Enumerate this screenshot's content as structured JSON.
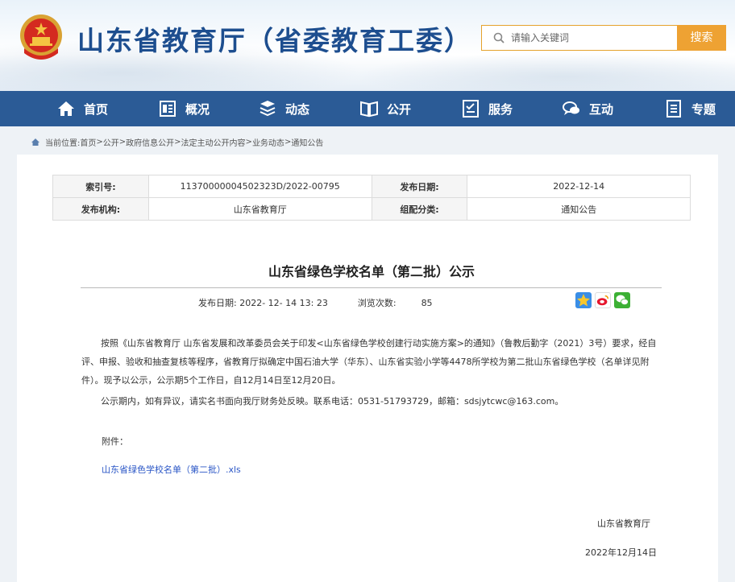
{
  "header": {
    "site_title": "山东省教育厅（省委教育工委）",
    "search_placeholder": "请输入关键词",
    "search_button": "搜索"
  },
  "nav": {
    "items": [
      {
        "label": "首页",
        "icon": "home-icon"
      },
      {
        "label": "概况",
        "icon": "overview-icon"
      },
      {
        "label": "动态",
        "icon": "news-icon"
      },
      {
        "label": "公开",
        "icon": "book-icon"
      },
      {
        "label": "服务",
        "icon": "service-icon"
      },
      {
        "label": "互动",
        "icon": "chat-icon"
      },
      {
        "label": "专题",
        "icon": "topic-icon"
      }
    ]
  },
  "breadcrumb": {
    "prefix": "当前位置:",
    "items": [
      "首页",
      "公开",
      "政府信息公开",
      "法定主动公开内容",
      "业务动态",
      "通知公告"
    ],
    "separator": " > "
  },
  "meta": {
    "index_label": "索引号:",
    "index_value": "11370000004502323D/2022-00795",
    "pubdate_label": "发布日期:",
    "pubdate_value": "2022-12-14",
    "org_label": "发布机构:",
    "org_value": "山东省教育厅",
    "category_label": "组配分类:",
    "category_value": "通知公告"
  },
  "article": {
    "title": "山东省绿色学校名单（第二批）公示",
    "pub_label": "发布日期:",
    "pub_datetime": "2022- 12- 14 13: 23",
    "views_label": "浏览次数:",
    "views": "85",
    "paragraph1": "按照《山东省教育厅    山东省发展和改革委员会关于印发<山东省绿色学校创建行动实施方案>的通知》（鲁教后勤字（2021）3号）要求，经自评、申报、验收和抽查复核等程序，省教育厅拟确定中国石油大学（华东）、山东省实验小学等4478所学校为第二批山东省绿色学校（名单详见附件）。现予以公示，公示期5个工作日，自12月14日至12月20日。",
    "paragraph2": "公示期内，如有异议，请实名书面向我厅财务处反映。联系电话：0531-51793729，邮箱：sdsjytcwc@163.com。",
    "attachment_label": "附件：",
    "attachment_link": "山东省绿色学校名单（第二批）.xls",
    "sign_org": "山东省教育厅",
    "sign_date": "2022年12月14日"
  },
  "colors": {
    "nav_bg": "#2b5b96",
    "title_blue": "#1d4e8f",
    "search_orange": "#eea233",
    "link_blue": "#2a56c6"
  }
}
